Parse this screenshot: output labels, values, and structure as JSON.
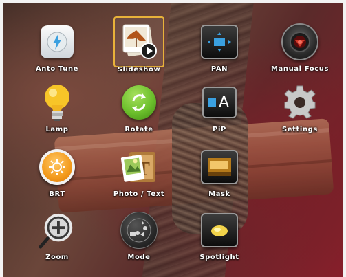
{
  "menu": {
    "items": [
      {
        "label": "Anto Tune"
      },
      {
        "label": "Slideshow",
        "selected": true
      },
      {
        "label": "PAN"
      },
      {
        "label": "Manual Focus"
      },
      {
        "label": "Lamp"
      },
      {
        "label": "Rotate"
      },
      {
        "label": "PiP",
        "icon_text": "A"
      },
      {
        "label": "Settings"
      },
      {
        "label": "BRT"
      },
      {
        "label": "Photo / Text"
      },
      {
        "label": "Mask"
      },
      {
        "label": "Zoom"
      },
      {
        "label": "Mode"
      },
      {
        "label": "Spotlight"
      }
    ]
  },
  "colors": {
    "selection_border": "#e8b23a",
    "label_text": "#ffffff",
    "rotate_green": "#6cbf2c",
    "brt_orange": "#f39a1c",
    "lamp_yellow": "#f7c528"
  },
  "icons": [
    "auto-tune-icon",
    "slideshow-icon",
    "pan-icon",
    "manual-focus-icon",
    "lamp-icon",
    "rotate-icon",
    "pip-icon",
    "settings-icon",
    "brightness-icon",
    "photo-text-icon",
    "mask-icon",
    "zoom-icon",
    "mode-icon",
    "spotlight-icon"
  ]
}
